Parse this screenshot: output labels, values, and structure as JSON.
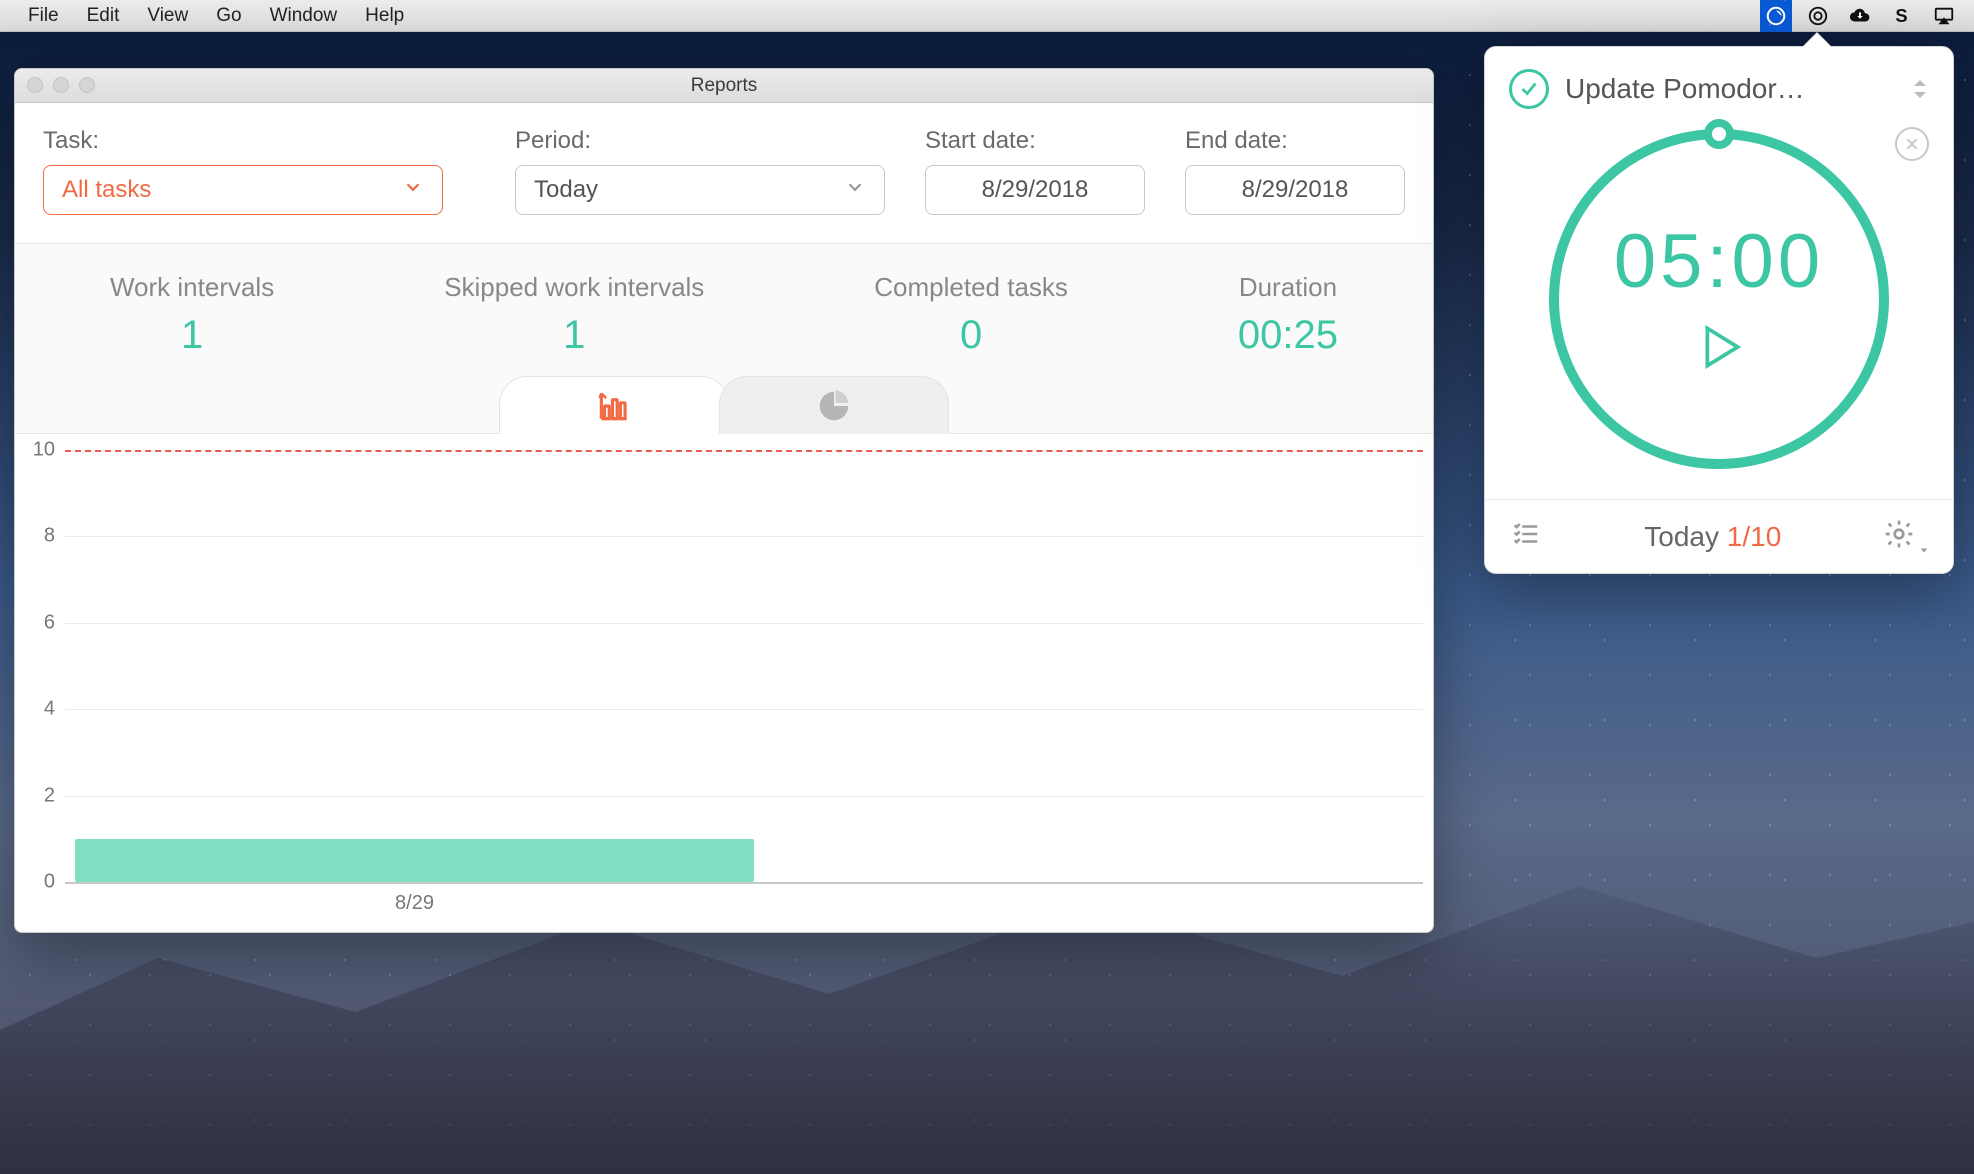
{
  "menubar": {
    "items": [
      "File",
      "Edit",
      "View",
      "Go",
      "Window",
      "Help"
    ]
  },
  "reports": {
    "title": "Reports",
    "filters": {
      "task_label": "Task:",
      "task_value": "All tasks",
      "period_label": "Period:",
      "period_value": "Today",
      "start_label": "Start date:",
      "start_value": "8/29/2018",
      "end_label": "End date:",
      "end_value": "8/29/2018"
    },
    "stats": {
      "work_label": "Work intervals",
      "work_value": "1",
      "skipped_label": "Skipped work intervals",
      "skipped_value": "1",
      "completed_label": "Completed tasks",
      "completed_value": "0",
      "duration_label": "Duration",
      "duration_value": "00:25"
    }
  },
  "chart_data": {
    "type": "bar",
    "categories": [
      "8/29"
    ],
    "values": [
      1
    ],
    "ylim": [
      0,
      10
    ],
    "yticks": [
      0,
      2,
      4,
      6,
      8,
      10
    ],
    "target_line": 10,
    "title": "",
    "xlabel": "",
    "ylabel": ""
  },
  "popover": {
    "task_name": "Update Pomodor…",
    "timer": "05:00",
    "footer_label": "Today",
    "footer_count": "1/10"
  },
  "colors": {
    "accent_green": "#3cc6a3",
    "accent_orange": "#f06b44",
    "target_red": "#e85a4f"
  }
}
